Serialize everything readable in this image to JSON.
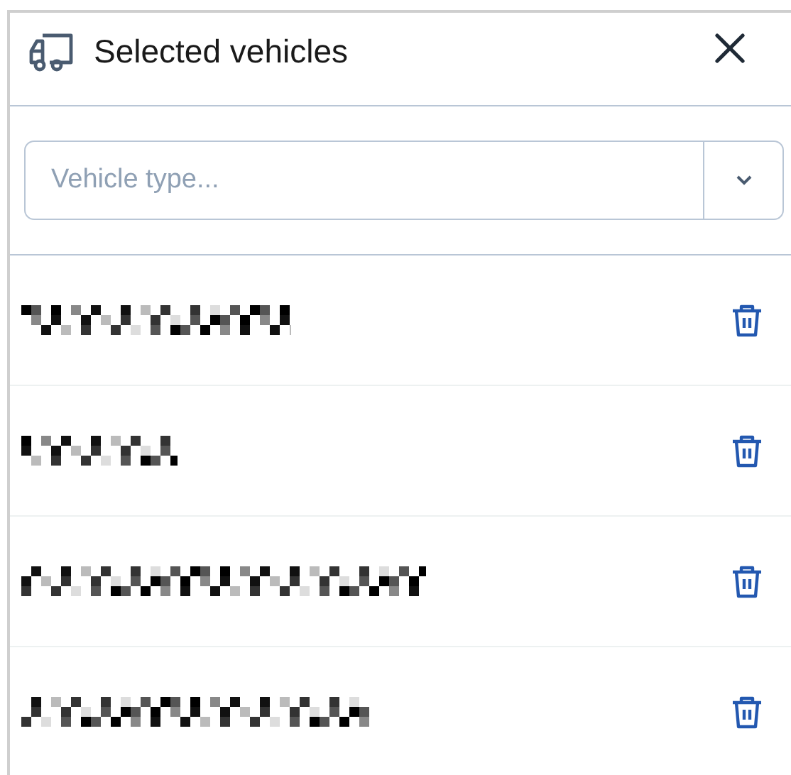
{
  "panel": {
    "title": "Selected vehicles"
  },
  "filter": {
    "placeholder": "Vehicle type..."
  },
  "vehicles": [
    {
      "kind": "redacted"
    },
    {
      "kind": "redacted"
    },
    {
      "kind": "redacted"
    },
    {
      "kind": "redacted"
    }
  ]
}
